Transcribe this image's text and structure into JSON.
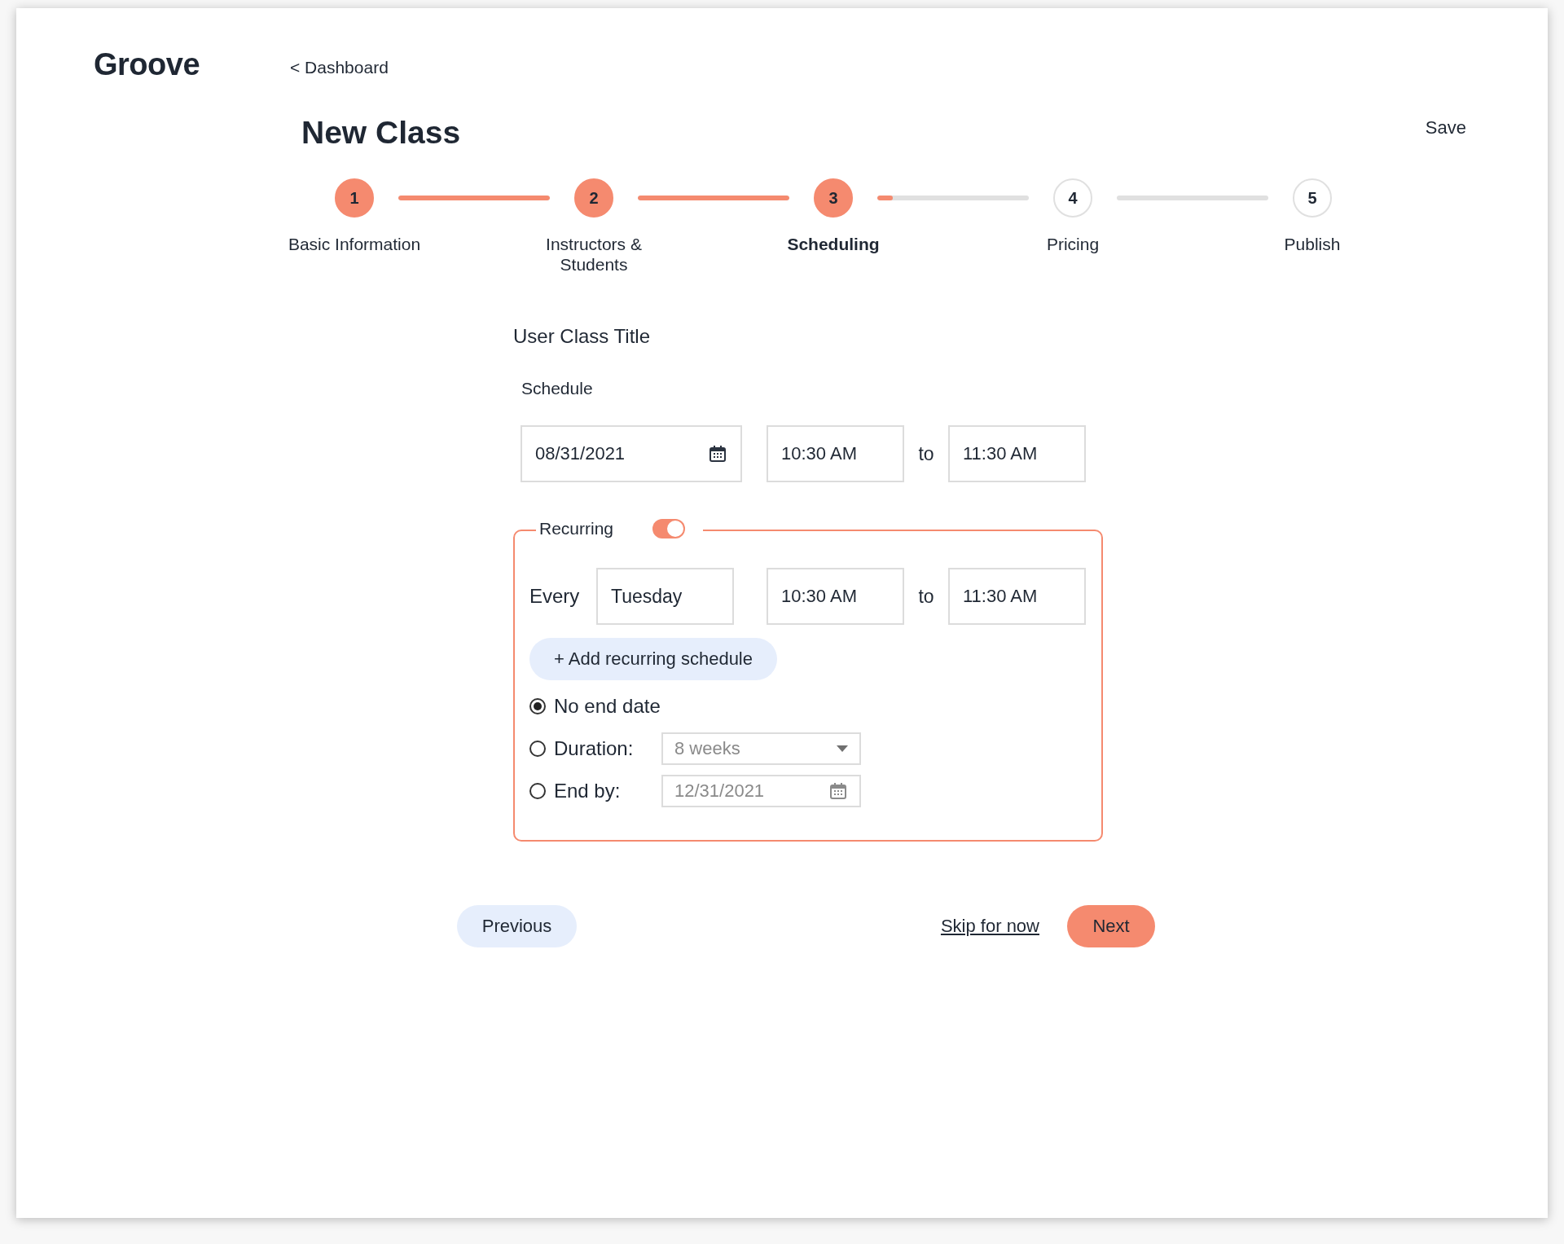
{
  "logo": "Groove",
  "back_link": "< Dashboard",
  "title": "New Class",
  "save": "Save",
  "steps": [
    {
      "number": "1",
      "label": "Basic Information",
      "reached": true,
      "selected": false
    },
    {
      "number": "2",
      "label": "Instructors & Students",
      "reached": true,
      "selected": false
    },
    {
      "number": "3",
      "label": "Scheduling",
      "reached": true,
      "selected": true
    },
    {
      "number": "4",
      "label": "Pricing",
      "reached": false,
      "selected": false
    },
    {
      "number": "5",
      "label": "Publish",
      "reached": false,
      "selected": false
    }
  ],
  "connectors": [
    {
      "level": 1
    },
    {
      "level": 1
    },
    {
      "level": 0.1
    },
    {
      "level": 0
    }
  ],
  "class_title": "User Class Title",
  "schedule": {
    "label": "Schedule",
    "date": "08/31/2021",
    "start": "10:30 AM",
    "separator": "to",
    "end": "11:30 AM"
  },
  "recurring": {
    "label": "Recurring",
    "on": true,
    "every_label": "Every",
    "day": "Tuesday",
    "start": "10:30 AM",
    "separator": "to",
    "end": "11:30 AM",
    "add_button": "+ Add recurring schedule",
    "end_options": [
      {
        "kind": "plain",
        "label": "No end date",
        "selected": true
      },
      {
        "kind": "select",
        "label": "Duration:",
        "value": "8 weeks",
        "selected": false,
        "disabled": true
      },
      {
        "kind": "date",
        "label": "End by:",
        "value": "12/31/2021",
        "selected": false,
        "disabled": true
      }
    ]
  },
  "buttons": {
    "previous": "Previous",
    "skip": "Skip for now",
    "next": "Next"
  }
}
